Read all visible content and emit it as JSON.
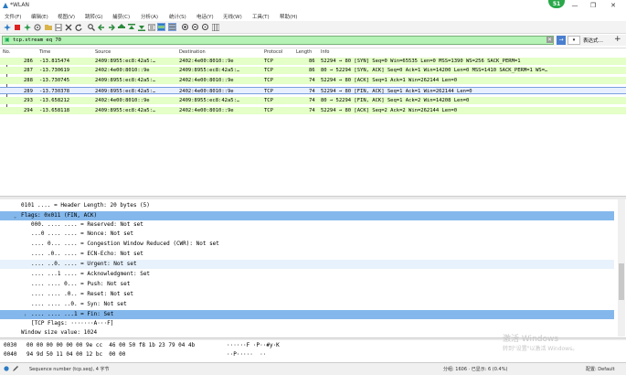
{
  "window": {
    "title": "*WLAN",
    "badge": "51",
    "min": "—",
    "restore": "❐",
    "close": "✕"
  },
  "menu": [
    "文件(F)",
    "编辑(E)",
    "视图(V)",
    "跳转(G)",
    "捕获(C)",
    "分析(A)",
    "统计(S)",
    "电话(Y)",
    "无线(W)",
    "工具(T)",
    "帮助(H)"
  ],
  "filter": {
    "value": "tcp.stream eq 70",
    "clear": "✕",
    "apply": "→",
    "dropdown": "▾",
    "expression_label": "表达式…",
    "add": "+"
  },
  "columns": [
    "No.",
    "Time",
    "Source",
    "Destination",
    "Protocol",
    "Length",
    "Info"
  ],
  "packets": [
    {
      "no": "286",
      "time": "-13.815474",
      "src": "2409:8955:ec8:42a5:…",
      "dst": "2402:4e00:8010::9e",
      "proto": "TCP",
      "len": "86",
      "info": "52294 → 80 [SYN] Seq=0 Win=65535 Len=0 MSS=1390 WS=256 SACK_PERM=1"
    },
    {
      "no": "287",
      "time": "-13.730619",
      "src": "2402:4e00:8010::9e",
      "dst": "2409:8955:ec8:42a5:…",
      "proto": "TCP",
      "len": "86",
      "info": "80 → 52294 [SYN, ACK] Seq=0 Ack=1 Win=14200 Len=0 MSS=1410 SACK_PERM=1 WS=…"
    },
    {
      "no": "288",
      "time": "-13.730745",
      "src": "2409:8955:ec8:42a5:…",
      "dst": "2402:4e00:8010::9e",
      "proto": "TCP",
      "len": "74",
      "info": "52294 → 80 [ACK] Seq=1 Ack=1 Win=262144 Len=0"
    },
    {
      "no": "289",
      "time": "-13.730378",
      "src": "2409:8955:ec8:42a5:…",
      "dst": "2402:4e00:8010::9e",
      "proto": "TCP",
      "len": "74",
      "info": "52294 → 80 [FIN, ACK] Seq=1 Ack=1 Win=262144 Len=0"
    },
    {
      "no": "293",
      "time": "-13.658212",
      "src": "2402:4e00:8010::9e",
      "dst": "2409:8955:ec8:42a5:…",
      "proto": "TCP",
      "len": "74",
      "info": "80 → 52294 [FIN, ACK] Seq=1 Ack=2 Win=14208 Len=0"
    },
    {
      "no": "294",
      "time": "-13.658118",
      "src": "2409:8955:ec8:42a5:…",
      "dst": "2402:4e00:8010::9e",
      "proto": "TCP",
      "len": "74",
      "info": "52294 → 80 [ACK] Seq=2 Ack=2 Win=262144 Len=0"
    }
  ],
  "details": [
    {
      "text": "0101 .... = Header Length: 20 bytes (5)",
      "indent": 0
    },
    {
      "text": "Flags: 0x011 (FIN, ACK)",
      "indent": 0,
      "arrow": "⌄"
    },
    {
      "text": "000. .... .... = Reserved: Not set",
      "indent": 1
    },
    {
      "text": "...0 .... .... = Nonce: Not set",
      "indent": 1
    },
    {
      "text": ".... 0... .... = Congestion Window Reduced (CWR): Not set",
      "indent": 1
    },
    {
      "text": ".... .0.. .... = ECN-Echo: Not set",
      "indent": 1
    },
    {
      "text": ".... ..0. .... = Urgent: Not set",
      "indent": 1
    },
    {
      "text": ".... ...1 .... = Acknowledgment: Set",
      "indent": 1
    },
    {
      "text": ".... .... 0... = Push: Not set",
      "indent": 1
    },
    {
      "text": ".... .... .0.. = Reset: Not set",
      "indent": 1
    },
    {
      "text": ".... .... ..0. = Syn: Not set",
      "indent": 1
    },
    {
      "text": ".... .... ...1 = Fin: Set",
      "indent": 1,
      "arrow": "›"
    },
    {
      "text": "[TCP Flags: ·······A···F]",
      "indent": 1
    },
    {
      "text": "Window size value: 1024",
      "indent": 0
    }
  ],
  "bytes": [
    {
      "offset": "0030",
      "hex": "00 00 00 00 00 00 9e cc  46 00 50 f8 1b 23 79 04 4b",
      "ascii": "······F ·P··#y·K"
    },
    {
      "offset": "0040",
      "hex": "94 9d 50 11 04 00 12 bc  00 00",
      "ascii": "··P·····  ··"
    }
  ],
  "status": {
    "field": "Sequence number (tcp.seq), 4 字节",
    "packets": "分组: 1606 · 已显示: 6 (0.4%)",
    "profile": "配置: Default"
  },
  "watermark": {
    "line1": "激活 Windows",
    "line2": "转到\"设置\"以激活 Windows。"
  },
  "colors": {
    "row_green": "#e4ffc7",
    "filter_green": "#b5f2b5",
    "detail_selected": "#84b8ec"
  }
}
